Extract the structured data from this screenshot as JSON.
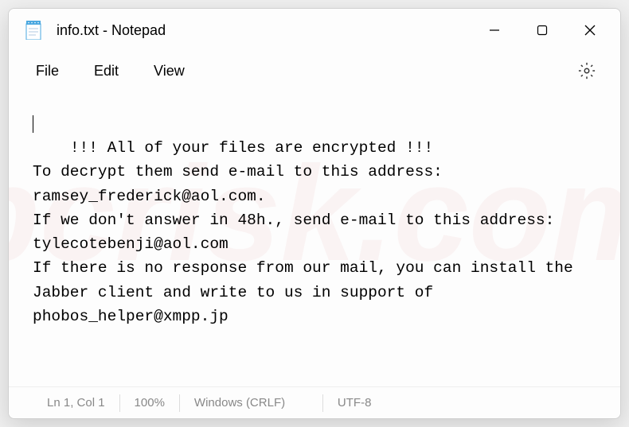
{
  "titlebar": {
    "title": "info.txt - Notepad"
  },
  "menubar": {
    "file": "File",
    "edit": "Edit",
    "view": "View"
  },
  "content": {
    "text": "!!! All of your files are encrypted !!!\nTo decrypt them send e-mail to this address: ramsey_frederick@aol.com.\nIf we don't answer in 48h., send e-mail to this address: tylecotebenji@aol.com\nIf there is no response from our mail, you can install the Jabber client and write to us in support of phobos_helper@xmpp.jp"
  },
  "statusbar": {
    "position": "Ln 1, Col 1",
    "zoom": "100%",
    "lineending": "Windows (CRLF)",
    "encoding": "UTF-8"
  }
}
